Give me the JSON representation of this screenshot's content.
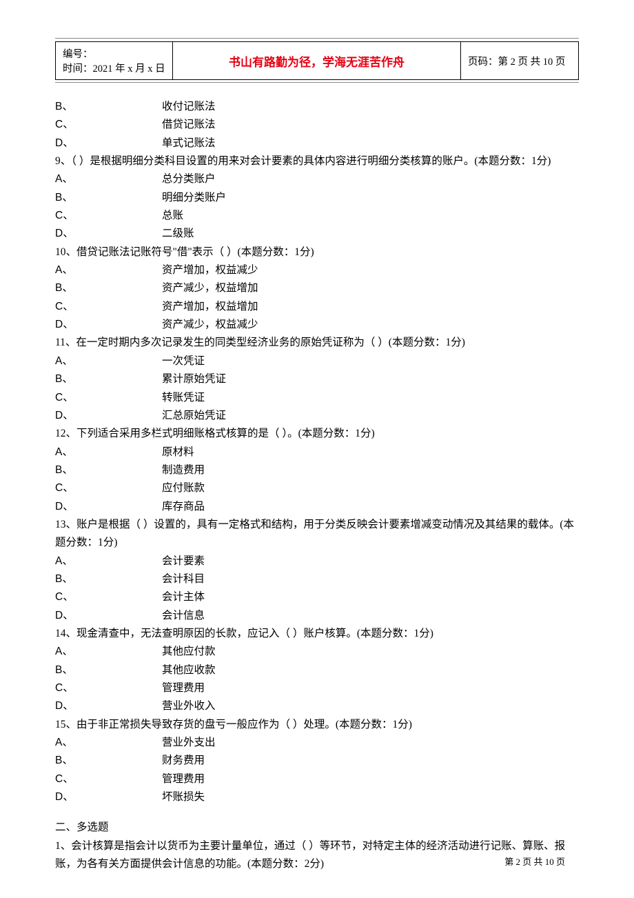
{
  "header": {
    "id_label": "编号：",
    "time_label": "时间：2021 年 x 月 x 日",
    "motto": "书山有路勤为径，学海无涯苦作舟",
    "page_label": "页码：第 2 页 共 10 页"
  },
  "opts_pre": [
    {
      "label": "B、",
      "text": "收付记账法"
    },
    {
      "label": "C、",
      "text": "借贷记账法"
    },
    {
      "label": "D、",
      "text": "单式记账法"
    }
  ],
  "questions": [
    {
      "q": "9、（  ）是根据明细分类科目设置的用来对会计要素的具体内容进行明细分类核算的账户。(本题分数：1分)",
      "opts": [
        {
          "label": "A、",
          "text": "总分类账户"
        },
        {
          "label": "B、",
          "text": "明细分类账户"
        },
        {
          "label": "C、",
          "text": "总账"
        },
        {
          "label": "D、",
          "text": "二级账"
        }
      ]
    },
    {
      "q": "10、借贷记账法记账符号\"借\"表示（  ）(本题分数：1分)",
      "opts": [
        {
          "label": "A、",
          "text": "资产增加，权益减少"
        },
        {
          "label": "B、",
          "text": "资产减少，权益增加"
        },
        {
          "label": "C、",
          "text": "资产增加，权益增加"
        },
        {
          "label": "D、",
          "text": "资产减少，权益减少"
        }
      ]
    },
    {
      "q": "11、在一定时期内多次记录发生的同类型经济业务的原始凭证称为（  ）(本题分数：1分)",
      "opts": [
        {
          "label": "A、",
          "text": "一次凭证"
        },
        {
          "label": "B、",
          "text": "累计原始凭证"
        },
        {
          "label": "C、",
          "text": "转账凭证"
        },
        {
          "label": "D、",
          "text": "汇总原始凭证"
        }
      ]
    },
    {
      "q": "12、下列适合采用多栏式明细账格式核算的是（  ）。(本题分数：1分)",
      "opts": [
        {
          "label": "A、",
          "text": "原材料"
        },
        {
          "label": "B、",
          "text": "制造费用"
        },
        {
          "label": "C、",
          "text": "应付账款"
        },
        {
          "label": "D、",
          "text": "库存商品"
        }
      ]
    },
    {
      "q": "13、账户是根据（  ）设置的，具有一定格式和结构，用于分类反映会计要素增减变动情况及其结果的载体。(本题分数：1分)",
      "opts": [
        {
          "label": "A、",
          "text": "会计要素"
        },
        {
          "label": "B、",
          "text": "会计科目"
        },
        {
          "label": "C、",
          "text": "会计主体"
        },
        {
          "label": "D、",
          "text": "会计信息"
        }
      ]
    },
    {
      "q": "14、现金清查中，无法查明原因的长款，应记入（  ）账户核算。(本题分数：1分)",
      "opts": [
        {
          "label": "A、",
          "text": "其他应付款"
        },
        {
          "label": "B、",
          "text": "其他应收款"
        },
        {
          "label": "C、",
          "text": "管理费用"
        },
        {
          "label": "D、",
          "text": "营业外收入"
        }
      ]
    },
    {
      "q": "15、由于非正常损失导致存货的盘亏一般应作为（  ）处理。(本题分数：1分)",
      "opts": [
        {
          "label": "A、",
          "text": "营业外支出"
        },
        {
          "label": "B、",
          "text": "财务费用"
        },
        {
          "label": "C、",
          "text": "管理费用"
        },
        {
          "label": "D、",
          "text": "坏账损失"
        }
      ]
    }
  ],
  "section2": {
    "heading": "二、多选题",
    "q1": "1、会计核算是指会计以货币为主要计量单位，通过（  ）等环节，对特定主体的经济活动进行记账、算账、报账，为各有关方面提供会计信息的功能。(本题分数：2分)"
  },
  "footer": "第 2 页 共 10 页"
}
